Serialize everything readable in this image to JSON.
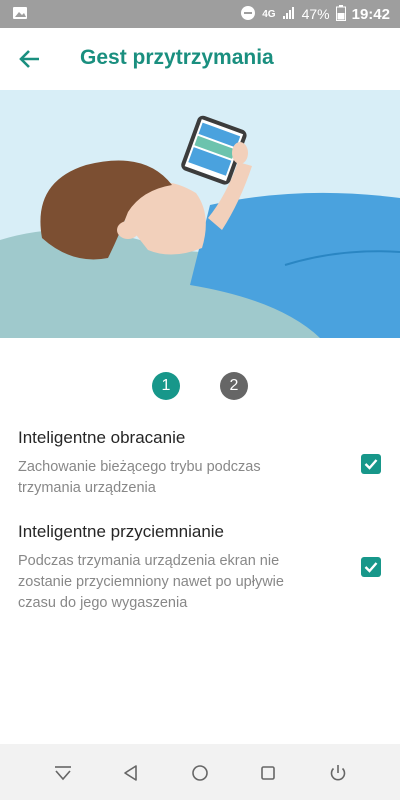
{
  "status_bar": {
    "network": "4G",
    "battery": "47%",
    "time": "19:42",
    "icons": [
      "image-icon",
      "do-not-disturb-icon",
      "signal-icon",
      "battery-icon"
    ]
  },
  "app_bar": {
    "title": "Gest przytrzymania",
    "back_icon": "arrow-back-icon"
  },
  "steps": [
    "1",
    "2"
  ],
  "settings": [
    {
      "title": "Inteligentne obracanie",
      "description_lines": [
        "Zachowanie bieżącego trybu podczas",
        "trzymania urządzenia"
      ],
      "checked": true
    },
    {
      "title": "Inteligentne przyciemnianie",
      "description_lines": [
        "Podczas trzymania urządzenia ekran nie",
        "zostanie przyciemniony nawet po upływie",
        "czasu do jego wygaszenia"
      ],
      "checked": true
    }
  ],
  "nav_bar": {
    "buttons": [
      "hide-nav-icon",
      "back-icon",
      "home-icon",
      "recents-icon",
      "power-icon"
    ]
  },
  "colors": {
    "accent": "#17978a",
    "title": "#1a8f7f",
    "status_bar": "#9e9e9e",
    "illustration_sky": "#d8eef7",
    "blanket": "#9fc9cc",
    "shirt": "#4aa2de"
  }
}
